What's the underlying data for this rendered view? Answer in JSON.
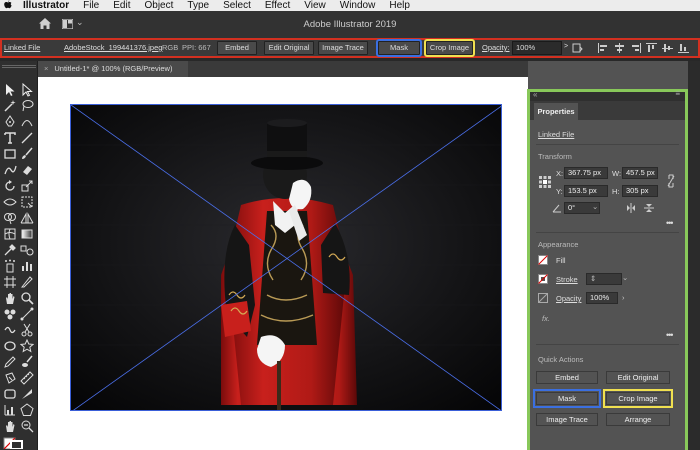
{
  "menubar": {
    "apple": "",
    "items": [
      "Illustrator",
      "File",
      "Edit",
      "Object",
      "Type",
      "Select",
      "Effect",
      "View",
      "Window",
      "Help"
    ]
  },
  "appbar": {
    "title": "Adobe Illustrator 2019"
  },
  "control_bar": {
    "linked_file": "Linked File",
    "file_name": "AdobeStock_199441376.jpeg",
    "color_mode": "RGB",
    "ppi": "PPI: 667",
    "embed": "Embed",
    "edit_original": "Edit Original",
    "image_trace": "Image Trace",
    "mask": "Mask",
    "crop_image": "Crop Image",
    "opacity_label": "Opacity:",
    "opacity_value": "100%",
    "opacity_arrow": ">"
  },
  "document": {
    "tab_close": "×",
    "tab_title": "Untitled-1* @ 100% (RGB/Preview)"
  },
  "properties": {
    "tab": "Properties",
    "linked_file": "Linked File",
    "transform": {
      "heading": "Transform",
      "x_label": "X:",
      "x": "367.75 px",
      "y_label": "Y:",
      "y": "153.5 px",
      "w_label": "W:",
      "w": "457.5 px",
      "h_label": "H:",
      "h": "305 px",
      "rotate": "0°"
    },
    "appearance": {
      "heading": "Appearance",
      "fill": "Fill",
      "stroke": "Stroke",
      "opacity_label": "Opacity",
      "opacity_value": "100%",
      "fx": "fx."
    },
    "quick_actions": {
      "heading": "Quick Actions",
      "embed": "Embed",
      "edit_original": "Edit Original",
      "mask": "Mask",
      "crop_image": "Crop Image",
      "image_trace": "Image Trace",
      "arrange": "Arrange"
    },
    "more": "•••"
  },
  "colors": {
    "control_bar_highlight": "#d33020",
    "panel_highlight": "#88c85a",
    "mask_highlight": "#3b6fe0",
    "crop_highlight": "#f0e050",
    "coat_red": "#c8201c"
  }
}
